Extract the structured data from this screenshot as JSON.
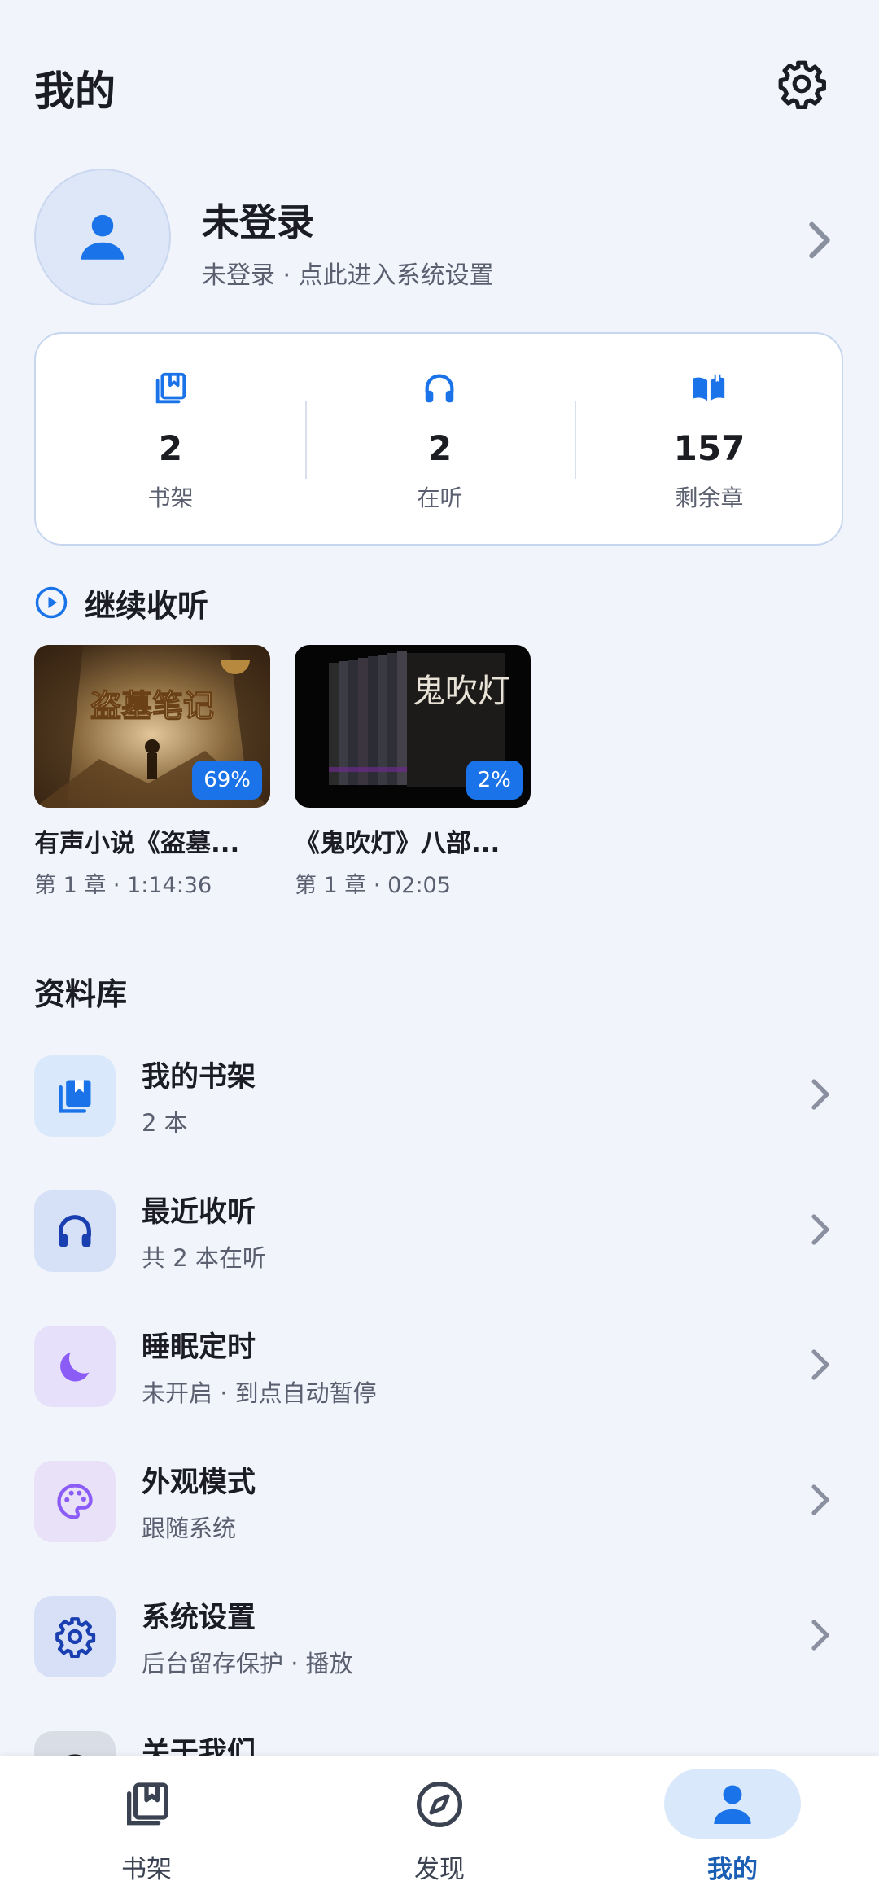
{
  "header": {
    "title": "我的",
    "settings_icon": "gear-icon"
  },
  "profile": {
    "name": "未登录",
    "subtitle": "未登录 · 点此进入系统设置",
    "avatar_icon": "person-icon"
  },
  "stats": [
    {
      "icon": "bookshelf-icon",
      "value": "2",
      "label": "书架"
    },
    {
      "icon": "headphones-icon",
      "value": "2",
      "label": "在听"
    },
    {
      "icon": "open-book-icon",
      "value": "157",
      "label": "剩余章"
    }
  ],
  "continue_listening": {
    "title": "继续收听",
    "items": [
      {
        "title": "有声小说《盗墓...",
        "meta": "第 1 章 · 1:14:36",
        "progress": "69%",
        "cover_text": "盗墓笔记"
      },
      {
        "title": "《鬼吹灯》八部...",
        "meta": "第 1 章 · 02:05",
        "progress": "2%",
        "cover_text": "鬼吹灯"
      }
    ]
  },
  "library": {
    "title": "资料库",
    "items": [
      {
        "label": "我的书架",
        "sub": "2 本",
        "icon": "bookshelf-icon"
      },
      {
        "label": "最近收听",
        "sub": "共 2 本在听",
        "icon": "headphones-icon"
      },
      {
        "label": "睡眠定时",
        "sub": "未开启 · 到点自动暂停",
        "icon": "moon-icon"
      },
      {
        "label": "外观模式",
        "sub": "跟随系统",
        "icon": "palette-icon"
      },
      {
        "label": "系统设置",
        "sub": "后台留存保护 · 播放",
        "icon": "gear-icon"
      },
      {
        "label": "关于我们",
        "sub": "",
        "icon": "info-icon"
      }
    ]
  },
  "bottom_nav": [
    {
      "label": "书架",
      "icon": "bookshelf-icon",
      "active": false
    },
    {
      "label": "发现",
      "icon": "compass-icon",
      "active": false
    },
    {
      "label": "我的",
      "icon": "person-icon",
      "active": true
    }
  ],
  "colors": {
    "background": "#f1f4fb",
    "accent": "#1a73e8",
    "nav_active_pill": "#d9e9fb",
    "nav_active_text": "#1a5fb4"
  }
}
